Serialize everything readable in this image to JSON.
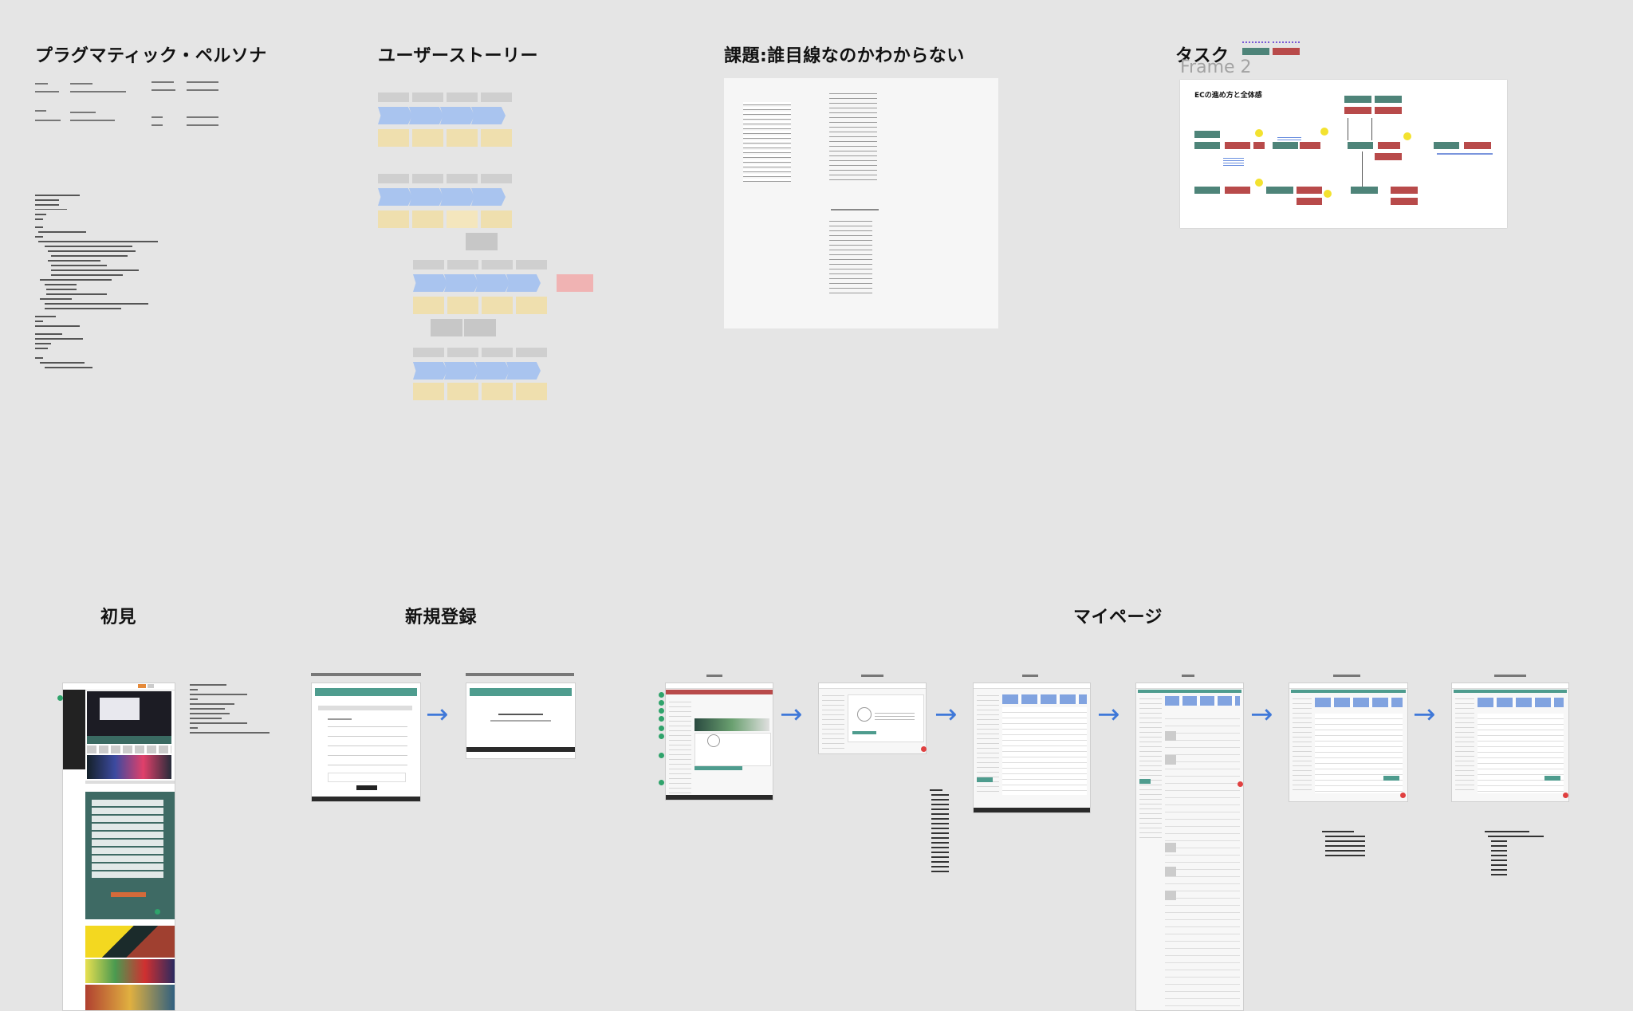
{
  "sections": {
    "pragmatic_persona": "プラグマティック・ペルソナ",
    "user_story": "ユーザーストーリー",
    "problem": "課題:誰目線なのかわからない",
    "task": "タスク",
    "first_view": "初見",
    "new_registration": "新規登録",
    "my_page": "マイページ"
  },
  "frame_label": "Frame 2",
  "task_flow_title": "ECの進め方と全体感"
}
